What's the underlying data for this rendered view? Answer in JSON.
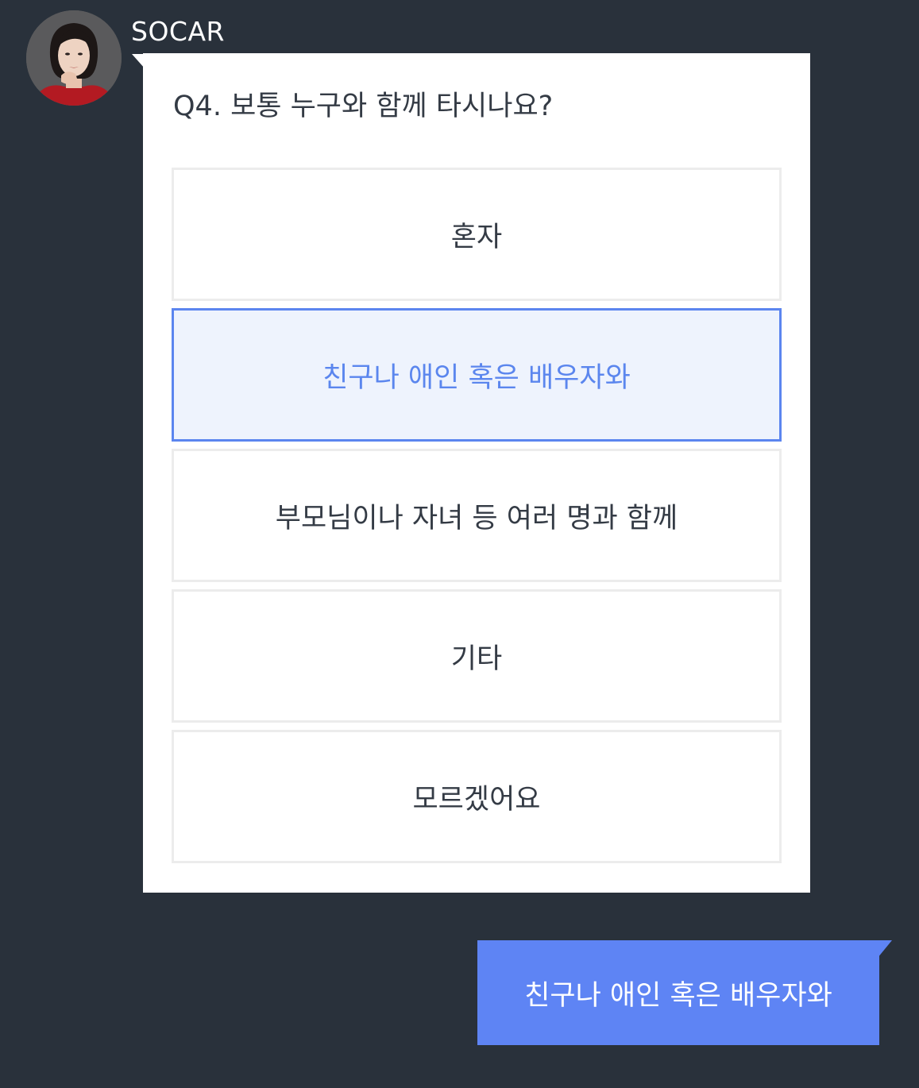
{
  "sender": {
    "name": "SOCAR",
    "avatar": "profile-photo"
  },
  "question_card": {
    "question": "Q4. 보통 누구와 함께 타시나요?",
    "options": [
      {
        "label": "혼자",
        "selected": false
      },
      {
        "label": "친구나 애인 혹은 배우자와",
        "selected": true
      },
      {
        "label": "부모님이나 자녀 등 여러 명과 함께",
        "selected": false
      },
      {
        "label": "기타",
        "selected": false
      },
      {
        "label": "모르겠어요",
        "selected": false
      }
    ]
  },
  "reply": {
    "text": "친구나 애인 혹은 배우자와"
  },
  "colors": {
    "background": "#29313b",
    "card": "#ffffff",
    "accent": "#5e84f4",
    "selected_bg": "#eef3fd",
    "option_border": "#ececec",
    "text": "#343b45"
  }
}
